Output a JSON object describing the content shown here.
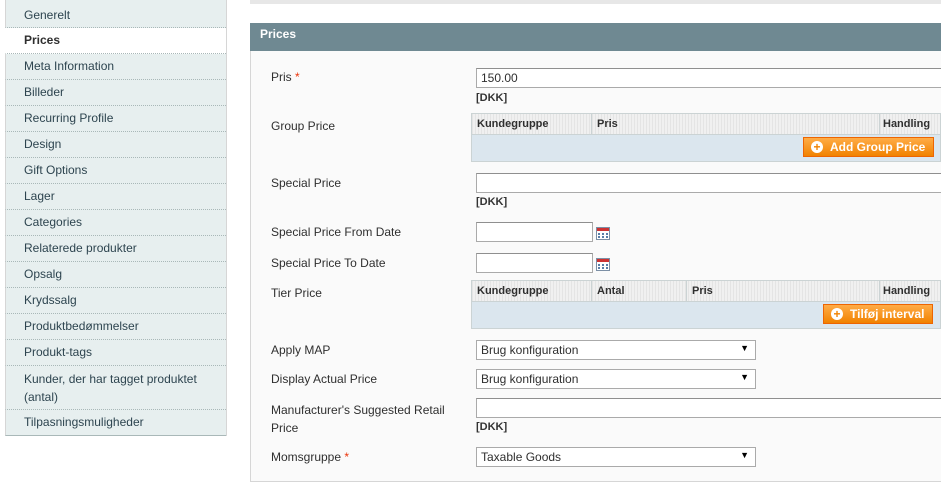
{
  "sidebar": {
    "items": [
      {
        "label": "Generelt"
      },
      {
        "label": "Prices"
      },
      {
        "label": "Meta Information"
      },
      {
        "label": "Billeder"
      },
      {
        "label": "Recurring Profile"
      },
      {
        "label": "Design"
      },
      {
        "label": "Gift Options"
      },
      {
        "label": "Lager"
      },
      {
        "label": "Categories"
      },
      {
        "label": "Relaterede produkter"
      },
      {
        "label": "Opsalg"
      },
      {
        "label": "Krydssalg"
      },
      {
        "label": "Produktbedømmelser"
      },
      {
        "label": "Produkt-tags"
      },
      {
        "label": "Kunder, der har tagget produktet (antal)"
      },
      {
        "label": "Tilpasningsmuligheder"
      }
    ]
  },
  "fieldset": {
    "title": "Prices"
  },
  "fields": {
    "price": {
      "label": "Pris",
      "required": "*",
      "value": "150.00",
      "note": "[DKK]"
    },
    "group_price": {
      "label": "Group Price",
      "col_group": "Kundegruppe",
      "col_price": "Pris",
      "col_action": "Handling",
      "button": "Add Group Price"
    },
    "special_price": {
      "label": "Special Price",
      "value": "",
      "note": "[DKK]"
    },
    "special_from": {
      "label": "Special Price From Date",
      "value": ""
    },
    "special_to": {
      "label": "Special Price To Date",
      "value": ""
    },
    "tier_price": {
      "label": "Tier Price",
      "col_group": "Kundegruppe",
      "col_qty": "Antal",
      "col_price": "Pris",
      "col_action": "Handling",
      "button": "Tilføj interval"
    },
    "apply_map": {
      "label": "Apply MAP",
      "value": "Brug konfiguration"
    },
    "display_actual": {
      "label": "Display Actual Price",
      "value": "Brug konfiguration"
    },
    "msrp": {
      "label_line1": "Manufacturer's Suggested Retail",
      "label_line2": "Price",
      "value": "",
      "note": "[DKK]"
    },
    "tax": {
      "label": "Momsgruppe",
      "required": "*",
      "value": "Taxable Goods"
    }
  },
  "colors": {
    "accent": "#f18200",
    "header": "#6f8992",
    "sidebar": "#e7efef"
  }
}
